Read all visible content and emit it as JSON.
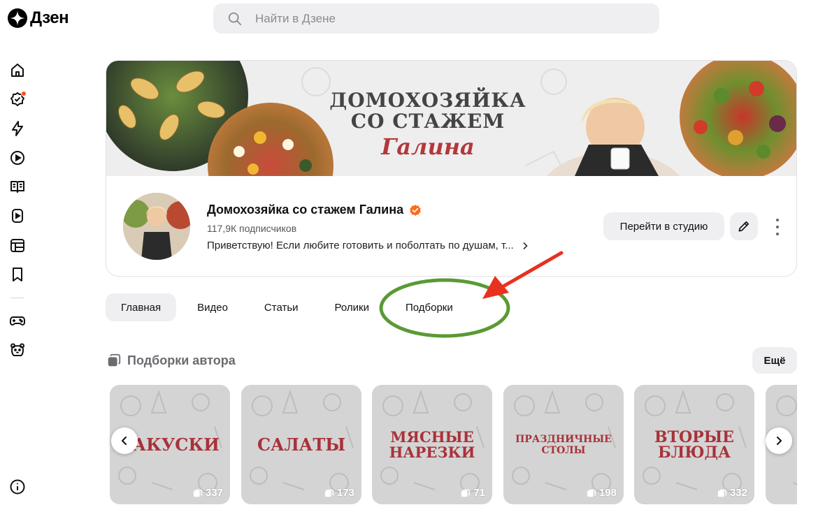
{
  "brand": {
    "name": "Дзен"
  },
  "search": {
    "placeholder": "Найти в Дзене"
  },
  "sidebar": {
    "items": [
      {
        "icon": "home-icon"
      },
      {
        "icon": "subscriptions-icon",
        "has_badge": true
      },
      {
        "icon": "lightning-icon"
      },
      {
        "icon": "video-icon"
      },
      {
        "icon": "articles-icon"
      },
      {
        "icon": "shorts-icon"
      },
      {
        "icon": "showcase-icon"
      },
      {
        "icon": "bookmark-icon"
      },
      {
        "icon": "gamepad-icon"
      },
      {
        "icon": "kids-icon"
      }
    ],
    "footer_icon": "info-icon"
  },
  "channel": {
    "banner_title": "ДОМОХОЗЯЙКА СО СТАЖЕМ",
    "banner_script": "Галина",
    "name": "Домохозяйка со стажем Галина",
    "verified": true,
    "subscribers": "117,9К подписчиков",
    "description": "Приветствую! Если любите готовить и поболтать по душам, т...",
    "studio_button": "Перейти в студию"
  },
  "tabs": [
    {
      "label": "Главная",
      "active": true
    },
    {
      "label": "Видео",
      "active": false
    },
    {
      "label": "Статьи",
      "active": false
    },
    {
      "label": "Ролики",
      "active": false
    },
    {
      "label": "Подборки",
      "active": false
    }
  ],
  "collections": {
    "title": "Подборки автора",
    "more_label": "Ещё",
    "items": [
      {
        "title": "ЗАКУСКИ",
        "count": "337"
      },
      {
        "title": "САЛАТЫ",
        "count": "173"
      },
      {
        "title": "МЯСНЫЕ НАРЕЗКИ",
        "count": "71"
      },
      {
        "title": "ПРАЗДНИЧНЫЕ СТОЛЫ",
        "count": "198"
      },
      {
        "title": "ВТОРЫЕ БЛЮДА",
        "count": "332"
      }
    ]
  },
  "colors": {
    "accent_orange": "#ff6a1a",
    "annotation_arrow": "#e8311f",
    "annotation_ellipse": "#5a9a35",
    "tile_title": "#a8323a"
  }
}
